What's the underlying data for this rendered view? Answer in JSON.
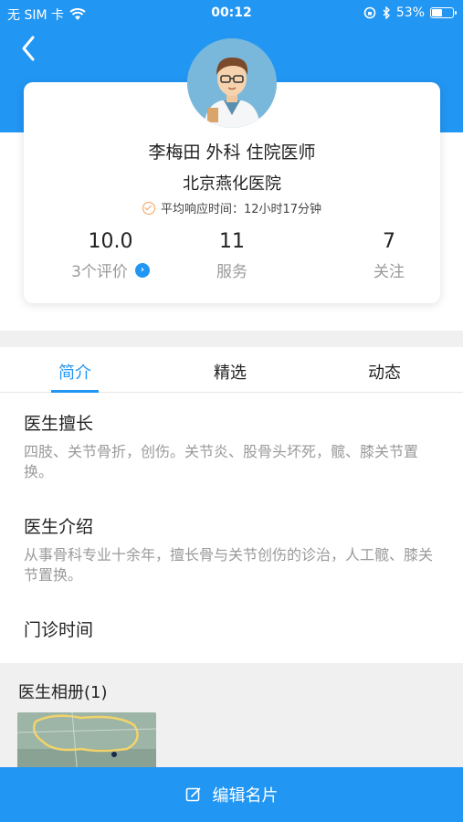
{
  "status_bar": {
    "carrier": "无 SIM 卡",
    "time": "00:12",
    "battery_percent": "53%",
    "battery_level": 0.53
  },
  "doctor": {
    "name_line": "李梅田 外科  住院医师",
    "hospital": "北京燕化医院",
    "response_time": "平均响应时间：12小时17分钟"
  },
  "stats": [
    {
      "value": "10.0",
      "label": "3个评价"
    },
    {
      "value": "11",
      "label": "服务"
    },
    {
      "value": "7",
      "label": "关注"
    }
  ],
  "tabs": [
    {
      "label": "简介",
      "active": true
    },
    {
      "label": "精选",
      "active": false
    },
    {
      "label": "动态",
      "active": false
    }
  ],
  "sections": {
    "specialty_title": "医生擅长",
    "specialty_text": "四肢、关节骨折，创伤。关节炎、股骨头坏死，髋、膝关节置换。",
    "intro_title": "医生介绍",
    "intro_text": "从事骨科专业十余年，擅长骨与关节创伤的诊治，人工髋、膝关节置换。",
    "clinic_title": "门诊时间"
  },
  "album": {
    "title": "医生相册(1)"
  },
  "bottom_bar": {
    "label": "编辑名片"
  },
  "colors": {
    "primary": "#2196f3",
    "muted_text": "#9a9a9a",
    "check_orange": "#f4a25c"
  }
}
